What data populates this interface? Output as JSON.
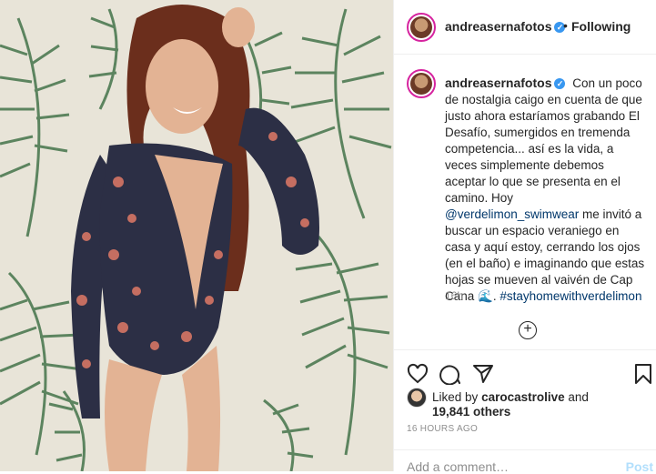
{
  "post": {
    "username": "andreasernafotos",
    "verified_icon": "verified-badge-icon",
    "follow_separator": "•",
    "follow_status": "Following",
    "caption_text": "Con un poco de nostalgia caigo en cuenta de que justo ahora estaríamos grabando El Desafío, sumergidos en tremenda competencia... así es la vida, a veces simplemente debemos aceptar lo que se presenta en el camino. Hoy",
    "caption_mention": "@verdelimon_swimwear",
    "caption_text2": "me invitó a buscar un espacio veraniego en casa y aquí estoy, cerrando los ojos (en el baño) e imaginando que estas hojas se mueven al vaivén de Cap Cana",
    "caption_emoji": "🌊",
    "caption_hashtag": "#stayhomewithverdelimon",
    "time_relative": "16h",
    "load_more_icon": "plus-circle-icon",
    "liked_by_prefix": "Liked by",
    "liked_by_user": "carocastrolive",
    "liked_by_and": "and",
    "likes_count": "19,841 others",
    "posted_ago": "16 HOURS AGO",
    "comment_placeholder": "Add a comment…",
    "post_button": "Post"
  },
  "colors": {
    "link": "#00376b",
    "verified": "#3897f0",
    "muted": "#8e8e8e",
    "post_disabled": "#b2dffc"
  }
}
